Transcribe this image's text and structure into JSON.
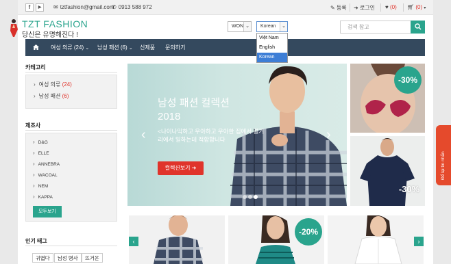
{
  "topbar": {
    "facebook_icon": "f",
    "youtube_icon": "▶",
    "email": "tztfashion@gmail.com",
    "phone": "0913 588 972",
    "register": "등록",
    "login": "로그인",
    "wishlist_count": "(0)",
    "cart_count": "(0)"
  },
  "header": {
    "logo_title": "TZT FASHION",
    "logo_subtitle": "당신은 유명해진다 !",
    "currency": "WON",
    "language": "Korean",
    "language_options": [
      "Việt Nam",
      "English",
      "Korean"
    ],
    "search_placeholder": "검색 참고"
  },
  "nav": {
    "items": [
      "여성 의류 (24)",
      "남성 패션 (6)",
      "신제품",
      "문의하기"
    ]
  },
  "sidebar": {
    "category_title": "카테고리",
    "categories": [
      {
        "label": "여성 의류",
        "count": "(24)"
      },
      {
        "label": "남성 패션",
        "count": "(6)"
      }
    ],
    "brand_title": "제조사",
    "brands": [
      "D&G",
      "ELLE",
      "ANNEBRA",
      "WACOAL",
      "NEM",
      "KAPPA"
    ],
    "view_all": "모두보기",
    "tags_title": "인기 태그",
    "tags": [
      "귀엽다",
      "남성 명사",
      "뜨거운"
    ]
  },
  "banner": {
    "title": "남성 패션 컬렉션 2018",
    "description": "<나이나믹하고 우아하고 우아한 집에서 걸거리에서 일하는데 적합합니다",
    "button": "컬렉션보기",
    "slide_count": 3,
    "active_slide": 2
  },
  "promos": {
    "badge1": "-30%",
    "badge2": "-30%",
    "badge3": "-20%"
  },
  "side_tab": "Để lại tin nhắn",
  "colors": {
    "accent": "#2aa48d",
    "nav": "#34495e",
    "red": "#e0342b",
    "side_tab": "#e54a2c"
  }
}
